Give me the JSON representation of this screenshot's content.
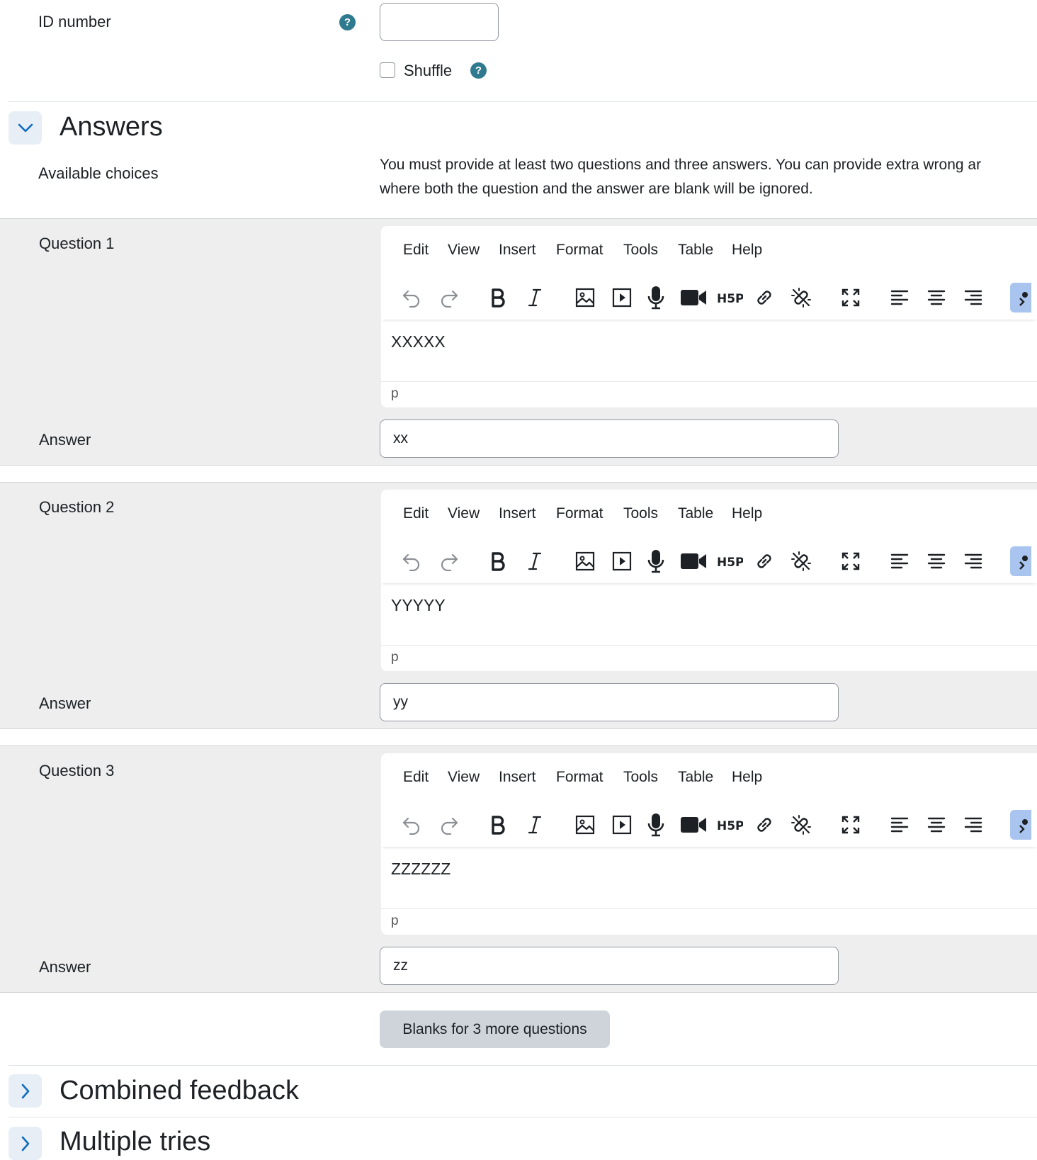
{
  "general": {
    "id_number_label": "ID number",
    "id_number_value": "",
    "shuffle_label": "Shuffle",
    "help_glyph": "?"
  },
  "answers_section": {
    "title": "Answers",
    "available_choices_label": "Available choices",
    "description_line1": "You must provide at least two questions and three answers. You can provide extra wrong ar",
    "description_line2": "where both the question and the answer are blank will be ignored."
  },
  "editor_menu": [
    "Edit",
    "View",
    "Insert",
    "Format",
    "Tools",
    "Table",
    "Help"
  ],
  "toolbar_icons": [
    "undo-icon",
    "redo-icon",
    "bold-icon",
    "italic-icon",
    "image-icon",
    "media-icon",
    "record-audio-icon",
    "record-video-icon",
    "h5p-icon",
    "link-icon",
    "unlink-icon",
    "fullscreen-icon",
    "align-left-icon",
    "align-center-icon",
    "align-right-icon",
    "accessibility-checker-icon"
  ],
  "questions": [
    {
      "label": "Question 1",
      "content": "XXXXX",
      "status_path": "p",
      "answer_label": "Answer",
      "answer_value": "xx"
    },
    {
      "label": "Question 2",
      "content": "YYYYY",
      "status_path": "p",
      "answer_label": "Answer",
      "answer_value": "yy"
    },
    {
      "label": "Question 3",
      "content": "ZZZZZZ",
      "status_path": "p",
      "answer_label": "Answer",
      "answer_value": "zz"
    }
  ],
  "blanks_button": "Blanks for 3 more questions",
  "combined_feedback_title": "Combined feedback",
  "multiple_tries_title": "Multiple tries",
  "colors": {
    "help_icon": "#2f7a8e",
    "section_toggle_bg": "#e8eef6",
    "toggle_chevron": "#0f6cbf",
    "question_bg": "#eeeeee",
    "button_secondary": "#ced4da",
    "accessibility_highlight": "#a9c4ee"
  }
}
